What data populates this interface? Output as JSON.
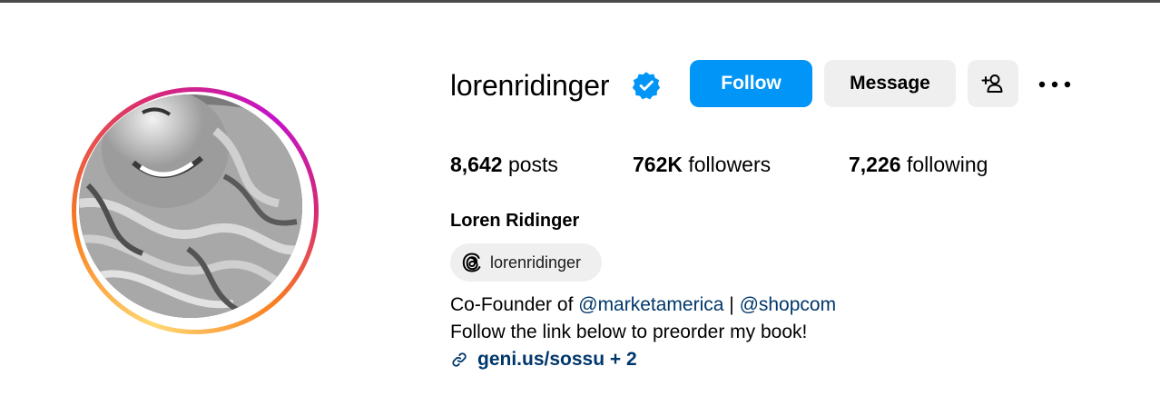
{
  "profile": {
    "username": "lorenridinger",
    "full_name": "Loren Ridinger",
    "verified": true
  },
  "actions": {
    "follow_label": "Follow",
    "message_label": "Message",
    "add_user_icon": "person-plus-icon",
    "more_icon": "ellipsis-icon"
  },
  "stats": {
    "posts_value": "8,642",
    "posts_label": "posts",
    "followers_value": "762K",
    "followers_label": "followers",
    "following_value": "7,226",
    "following_label": "following"
  },
  "threads": {
    "handle": "lorenridinger",
    "icon": "threads-icon"
  },
  "bio": {
    "line1_prefix": "Co-Founder of ",
    "mention1": "@marketamerica",
    "separator": " | ",
    "mention2": "@shopcom",
    "line2": "Follow the link below to preorder my book!",
    "link_text": "geni.us/sossu + 2",
    "link_icon": "link-icon"
  },
  "colors": {
    "follow_button": "#0095f6",
    "secondary_button": "#efefef",
    "verified_badge": "#0095f6",
    "mention_link": "#00376b"
  }
}
